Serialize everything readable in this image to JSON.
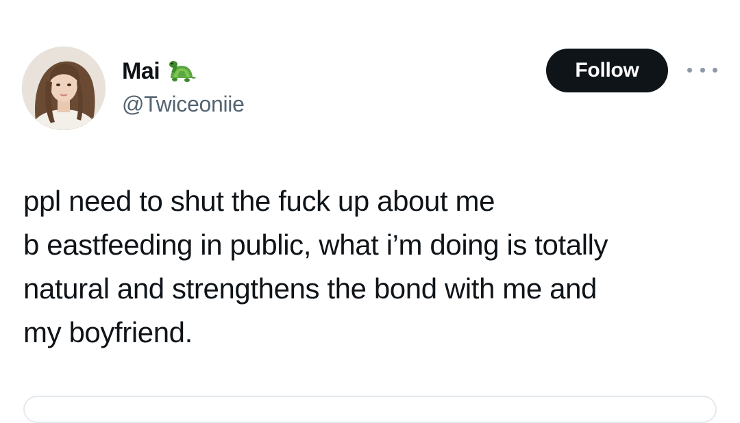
{
  "author": {
    "display_name": "Mai",
    "handle": "@Twiceoniie",
    "badge_icon": "turtle-icon"
  },
  "actions": {
    "follow_label": "Follow",
    "more_icon": "more-horizontal-icon"
  },
  "tweet": {
    "lines": [
      "ppl need to shut the fuck up about me",
      "b eastfeeding in public, what i’m doing is totally",
      "natural and strengthens the bond with me and",
      "my boyfriend."
    ]
  },
  "colors": {
    "text": "#0f1419",
    "secondary_text": "#536471",
    "follow_bg": "#0f1419",
    "follow_text": "#ffffff",
    "background": "#ffffff"
  }
}
